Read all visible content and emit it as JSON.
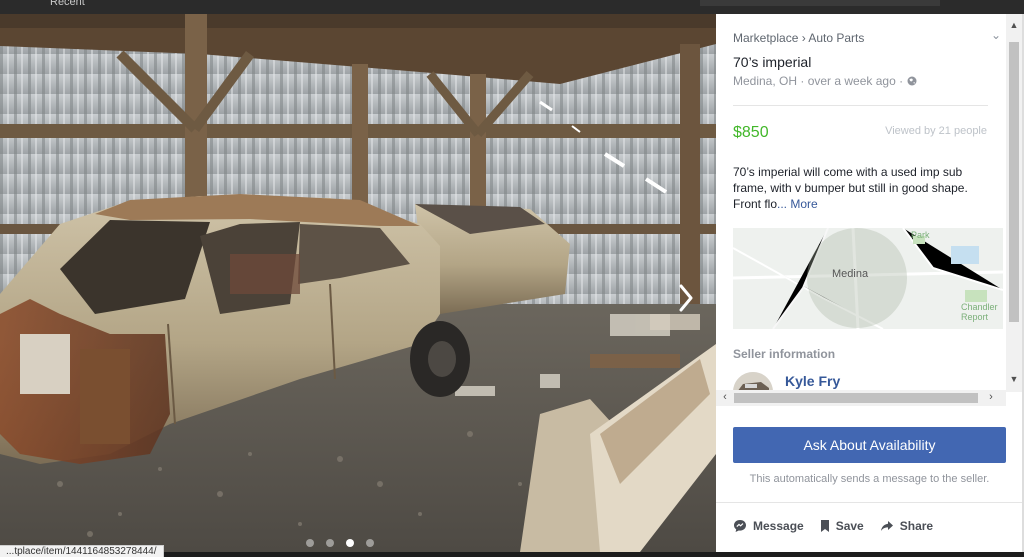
{
  "top_bar": {
    "left_text": "Recent"
  },
  "photo": {
    "carousel_dot_count": 4,
    "active_dot_index": 2,
    "next_icon": "chevron-right-icon"
  },
  "status_bar": {
    "url": "...tplace/item/1441164853278444/"
  },
  "listing": {
    "breadcrumb": "Marketplace › Auto Parts",
    "title": "70’s imperial",
    "meta": "Medina, OH · over a week ago ·",
    "price": "$850",
    "views": "Viewed by 21 people",
    "description": "70’s imperial will come with a used imp sub frame, with v bumper but still in good shape. Front flo",
    "more_label": "... More",
    "price_color": "#42b72a"
  },
  "map": {
    "city_label": "Medina",
    "park_label": "Park",
    "corner_label_1": "Chandler",
    "corner_label_2": "Report"
  },
  "seller": {
    "heading": "Seller information",
    "name": "Kyle Fry"
  },
  "cta": {
    "button_label": "Ask About Availability",
    "note": "This automatically sends a message to the seller.",
    "button_color": "#4267b2"
  },
  "actions": [
    {
      "label": "Message",
      "icon": "message-bubble-icon"
    },
    {
      "label": "Save",
      "icon": "bookmark-icon"
    },
    {
      "label": "Share",
      "icon": "share-arrow-icon"
    }
  ]
}
